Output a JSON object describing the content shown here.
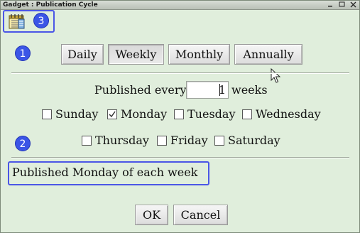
{
  "window": {
    "title": "Gadget : Publication Cycle",
    "controls": {
      "minimize": "▫",
      "maximize": "▫",
      "close": "✕"
    }
  },
  "annotations": {
    "badge1": "1",
    "badge2": "2",
    "badge3": "3"
  },
  "frequency": {
    "options": [
      "Daily",
      "Weekly",
      "Monthly",
      "Annually"
    ],
    "selected": "Weekly"
  },
  "interval": {
    "prefix": "Published every",
    "value": "1",
    "suffix": "weeks"
  },
  "days": [
    {
      "label": "Sunday",
      "checked": false
    },
    {
      "label": "Monday",
      "checked": true
    },
    {
      "label": "Tuesday",
      "checked": false
    },
    {
      "label": "Wednesday",
      "checked": false
    },
    {
      "label": "Thursday",
      "checked": false
    },
    {
      "label": "Friday",
      "checked": false
    },
    {
      "label": "Saturday",
      "checked": false
    }
  ],
  "summary": "Published Monday of each week",
  "buttons": {
    "ok": "OK",
    "cancel": "Cancel"
  },
  "colors": {
    "annotation": "#3b55e6",
    "background": "#e0eedc"
  }
}
